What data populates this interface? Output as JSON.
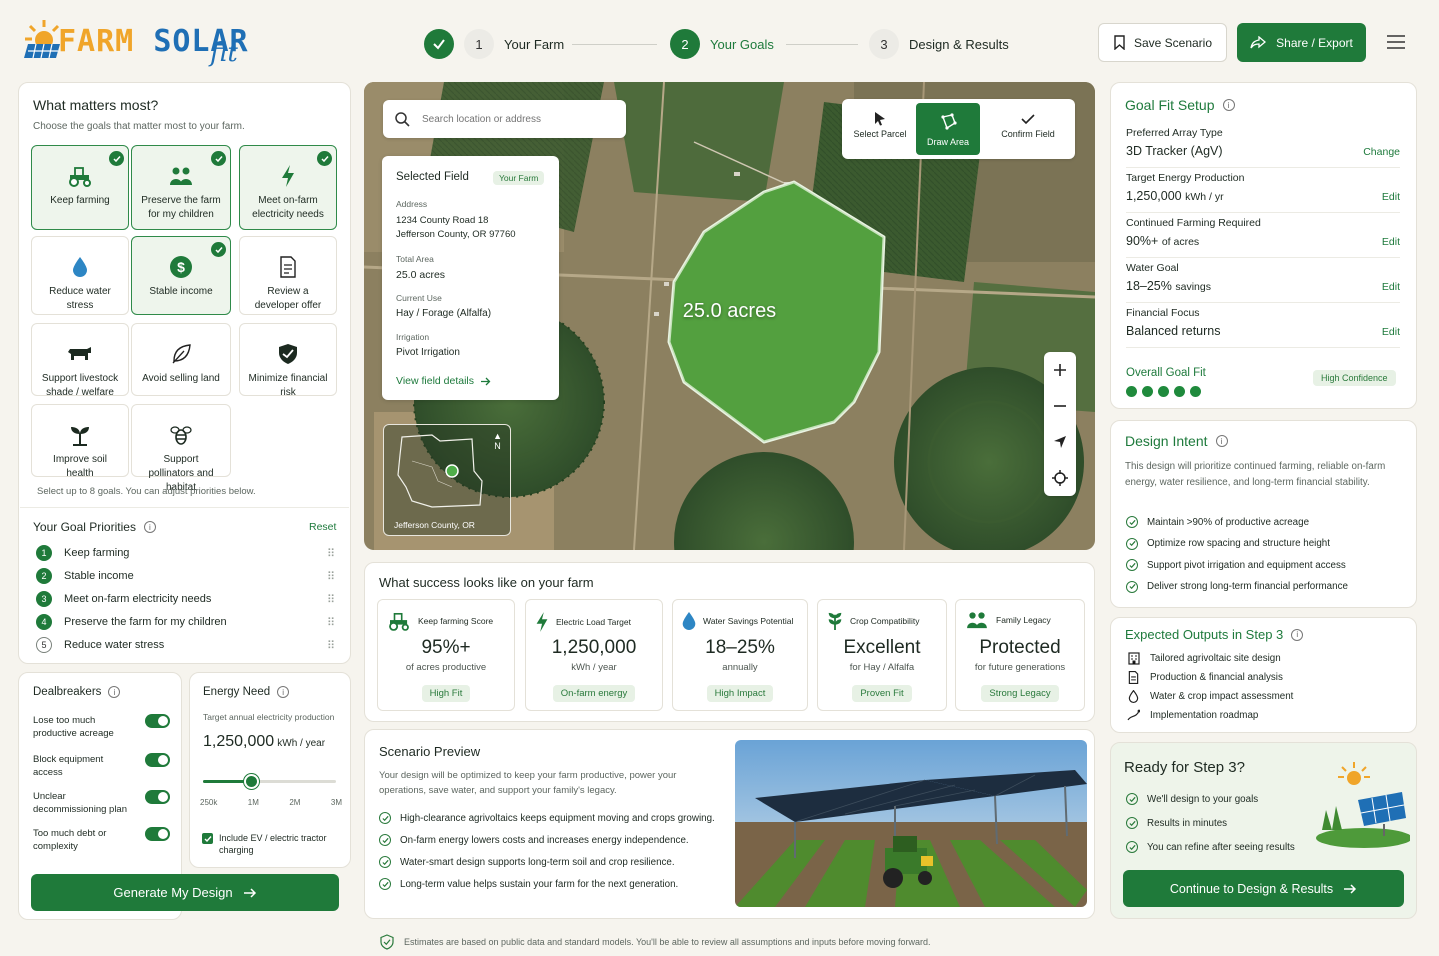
{
  "brand": {
    "word1": "FARM",
    "word2": "SOLAR",
    "suffix": "fit"
  },
  "steps": [
    {
      "num": "1",
      "label": "Your Farm",
      "state": "done"
    },
    {
      "num": "2",
      "label": "Your Goals",
      "state": "active"
    },
    {
      "num": "3",
      "label": "Design & Results",
      "state": "todo"
    }
  ],
  "header": {
    "save_label": "Save Scenario",
    "share_label": "Share / Export"
  },
  "goals_panel": {
    "title": "What matters most?",
    "subtitle": "Choose the goals that matter most to your farm.",
    "footnote": "Select up to 8 goals. You can adjust priorities below.",
    "goals": [
      {
        "label": "Keep farming",
        "icon": "tractor-icon",
        "selected": true
      },
      {
        "label": "Preserve the farm for my children",
        "icon": "family-icon",
        "selected": true
      },
      {
        "label": "Meet on-farm electricity needs",
        "icon": "lightning-icon",
        "selected": true
      },
      {
        "label": "Reduce water stress",
        "icon": "water-drop-icon",
        "selected": false
      },
      {
        "label": "Stable income",
        "icon": "dollar-icon",
        "selected": true
      },
      {
        "label": "Review a developer offer",
        "icon": "document-icon",
        "selected": false
      },
      {
        "label": "Support livestock shade / welfare",
        "icon": "cow-icon",
        "selected": false
      },
      {
        "label": "Avoid selling land",
        "icon": "leaf-icon",
        "selected": false
      },
      {
        "label": "Minimize financial risk",
        "icon": "shield-icon",
        "selected": false
      },
      {
        "label": "Improve soil health",
        "icon": "sprout-icon",
        "selected": false
      },
      {
        "label": "Support pollinators and habitat",
        "icon": "bee-icon",
        "selected": false
      }
    ]
  },
  "priorities": {
    "title": "Your Goal Priorities",
    "reset_label": "Reset",
    "items": [
      {
        "num": "1",
        "label": "Keep farming"
      },
      {
        "num": "2",
        "label": "Stable income"
      },
      {
        "num": "3",
        "label": "Meet on-farm electricity needs"
      },
      {
        "num": "4",
        "label": "Preserve the farm for my children"
      },
      {
        "num": "5",
        "label": "Reduce water stress"
      }
    ]
  },
  "dealbreakers": {
    "title": "Dealbreakers",
    "items": [
      {
        "label": "Lose too much productive acreage",
        "on": true
      },
      {
        "label": "Block equipment access",
        "on": true
      },
      {
        "label": "Unclear decommissioning plan",
        "on": true
      },
      {
        "label": "Too much debt or complexity",
        "on": true
      }
    ]
  },
  "energy": {
    "title": "Energy Need",
    "subtitle": "Target annual electricity production",
    "value": "1,250,000",
    "unit": "kWh / year",
    "slider_fraction": 0.36,
    "ticks": [
      "250k",
      "1M",
      "2M",
      "3M"
    ],
    "ev_label": "Include EV / electric tractor charging",
    "ev_checked": true
  },
  "generate_label": "Generate My Design",
  "map": {
    "search_placeholder": "Search location or address",
    "tools": [
      {
        "label": "Select Parcel",
        "icon": "cursor-icon"
      },
      {
        "label": "Draw Area",
        "icon": "polygon-icon",
        "active": true
      },
      {
        "label": "Confirm Field",
        "icon": "check-icon"
      }
    ],
    "field_label": "25.0 acres",
    "inset_label": "Jefferson County, OR",
    "north": "N",
    "field_card": {
      "title": "Selected Field",
      "badge": "Your Farm",
      "address_label": "Address",
      "address1": "1234 County Road 18",
      "address2": "Jefferson County, OR 97760",
      "area_label": "Total Area",
      "area": "25.0 acres",
      "use_label": "Current Use",
      "use": "Hay / Forage (Alfalfa)",
      "irrigation_label": "Irrigation",
      "irrigation": "Pivot Irrigation",
      "link": "View field details"
    }
  },
  "success": {
    "title": "What success looks like on your farm",
    "cards": [
      {
        "title": "Keep farming Score",
        "icon": "tractor-icon",
        "value": "95%+",
        "sub": "of acres productive",
        "pill": "High Fit"
      },
      {
        "title": "Electric Load Target",
        "icon": "lightning-icon",
        "value": "1,250,000",
        "sub": "kWh / year",
        "pill": "On-farm energy"
      },
      {
        "title": "Water Savings Potential",
        "icon": "water-drop-icon",
        "value": "18–25%",
        "sub": "annually",
        "pill": "High Impact"
      },
      {
        "title": "Crop Compatibility",
        "icon": "crop-icon",
        "value": "Excellent",
        "sub": "for Hay / Alfalfa",
        "pill": "Proven Fit"
      },
      {
        "title": "Family Legacy",
        "icon": "family-icon",
        "value": "Protected",
        "sub": "for future generations",
        "pill": "Strong Legacy"
      }
    ]
  },
  "scenario": {
    "title": "Scenario Preview",
    "text": "Your design will be optimized to keep your farm productive, power your operations, save water, and support your family's legacy.",
    "bullets": [
      "High-clearance agrivoltaics keeps equipment moving and crops growing.",
      "On-farm energy lowers costs and increases energy independence.",
      "Water-smart design supports long-term soil and crop resilience.",
      "Long-term value helps sustain your farm for the next generation."
    ]
  },
  "goal_fit": {
    "title": "Goal Fit Setup",
    "rows": [
      {
        "label": "Preferred Array Type",
        "value": "3D Tracker (AgV)",
        "unit": "",
        "action": "Change"
      },
      {
        "label": "Target Energy Production",
        "value": "1,250,000",
        "unit": "kWh / yr",
        "action": "Edit"
      },
      {
        "label": "Continued Farming Required",
        "value": "90%+",
        "unit": "of acres",
        "action": "Edit"
      },
      {
        "label": "Water Goal",
        "value": "18–25%",
        "unit": "savings",
        "action": "Edit"
      },
      {
        "label": "Financial Focus",
        "value": "Balanced returns",
        "unit": "",
        "action": "Edit"
      }
    ],
    "overall_label": "Overall Goal Fit",
    "overall_dots": 5,
    "overall_badge": "High Confidence"
  },
  "design_intent": {
    "title": "Design Intent",
    "text": "This design will prioritize continued farming, reliable on-farm energy, water resilience, and long-term financial stability.",
    "bullets": [
      "Maintain >90% of productive acreage",
      "Optimize row spacing and structure height",
      "Support pivot irrigation and equipment access",
      "Deliver strong long-term financial performance"
    ]
  },
  "outputs": {
    "title": "Expected Outputs in Step 3",
    "items": [
      {
        "label": "Tailored agrivoltaic site design",
        "icon": "building-icon"
      },
      {
        "label": "Production & financial analysis",
        "icon": "document-icon"
      },
      {
        "label": "Water & crop impact assessment",
        "icon": "water-drop-icon"
      },
      {
        "label": "Implementation roadmap",
        "icon": "route-icon"
      }
    ]
  },
  "ready": {
    "title": "Ready for Step 3?",
    "items": [
      "We'll design to your goals",
      "Results in minutes",
      "You can refine after seeing results"
    ],
    "button": "Continue to Design & Results"
  },
  "footer": "Estimates are based on public data and standard models. You'll be able to review all assumptions and inputs before moving forward.",
  "colors": {
    "primary": "#1f7a3a",
    "accent_orange": "#f0a52a",
    "accent_blue": "#1f6fb5",
    "background": "#f6f4ee"
  }
}
